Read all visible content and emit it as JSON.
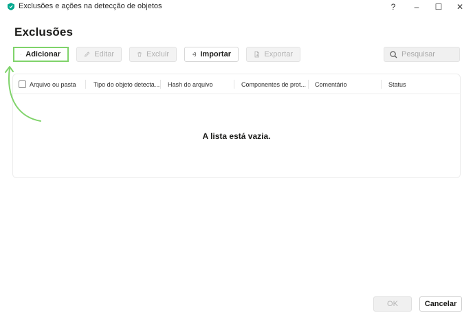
{
  "window": {
    "title": "Exclusões e ações na detecção de objetos",
    "help": "?",
    "minimize": "–",
    "maximize": "☐",
    "close": "✕"
  },
  "page": {
    "title": "Exclusões"
  },
  "toolbar": {
    "add_label": "Adicionar",
    "edit_label": "Editar",
    "delete_label": "Excluir",
    "import_label": "Importar",
    "export_label": "Exportar",
    "icons": {
      "add": "plus-icon",
      "edit": "pencil-icon",
      "delete": "trash-icon",
      "import": "import-icon",
      "export": "export-icon"
    },
    "disabled": [
      "edit",
      "delete",
      "export"
    ]
  },
  "search": {
    "placeholder": "Pesquisar",
    "value": ""
  },
  "table": {
    "columns": [
      "Arquivo ou pasta",
      "Tipo do objeto detecta...",
      "Hash do arquivo",
      "Componentes de prot...",
      "Comentário",
      "Status"
    ],
    "rows": [],
    "empty_message": "A lista está vazia."
  },
  "footer": {
    "ok_label": "OK",
    "cancel_label": "Cancelar"
  },
  "colors": {
    "highlight": "#7fd36a",
    "accent": "#00a88e"
  }
}
